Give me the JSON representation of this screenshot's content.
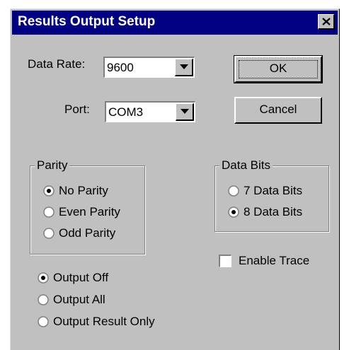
{
  "window": {
    "title": "Results Output Setup"
  },
  "data_rate": {
    "label": "Data Rate:",
    "value": "9600"
  },
  "port": {
    "label": "Port:",
    "value": "COM3"
  },
  "buttons": {
    "ok": "OK",
    "cancel": "Cancel"
  },
  "parity": {
    "legend": "Parity",
    "options": [
      "No Parity",
      "Even Parity",
      "Odd Parity"
    ],
    "selected": "No Parity"
  },
  "data_bits": {
    "legend": "Data Bits",
    "options": [
      "7 Data Bits",
      "8 Data Bits"
    ],
    "selected": "8 Data Bits"
  },
  "enable_trace": {
    "label": "Enable Trace",
    "checked": false
  },
  "output": {
    "options": [
      "Output Off",
      "Output All",
      "Output Result Only"
    ],
    "selected": "Output Off"
  },
  "colors": {
    "titlebar": "#000080",
    "face": "#c0c0c0"
  }
}
